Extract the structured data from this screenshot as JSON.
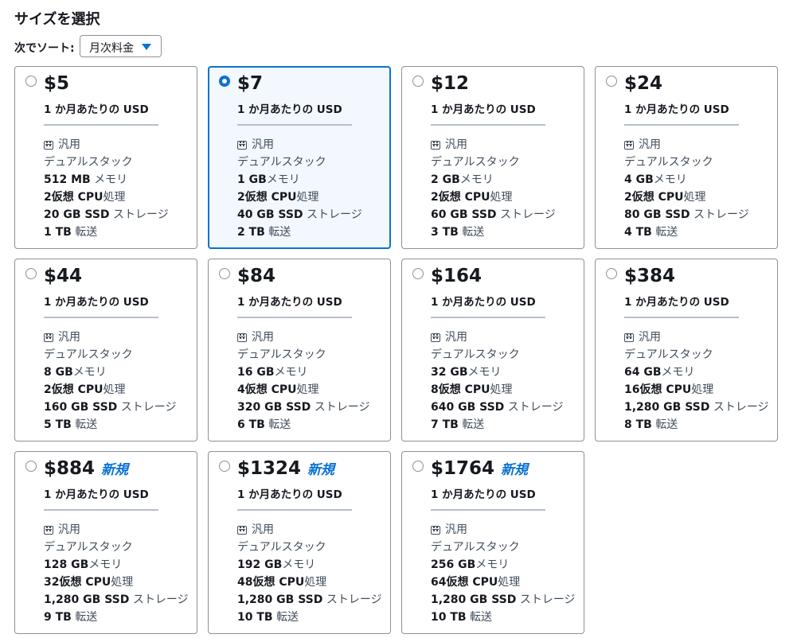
{
  "header": {
    "title": "サイズを選択",
    "sort_label": "次でソート:",
    "sort_value": "月次料金"
  },
  "labels": {
    "unit": "1 か月あたりの USD",
    "general": "汎用",
    "dual_stack": "デュアルスタック",
    "memory_suffix": "メモリ",
    "vcpu_suffix": "仮想 CPU",
    "processing": "処理",
    "storage_suffix": "GB SSD",
    "storage_word": " ストレージ",
    "transfer_suffix": "TB",
    "transfer_word": " 転送",
    "new_badge": "新規"
  },
  "plans": [
    {
      "price": "$5",
      "memory": "512 MB",
      "memory_spaced": true,
      "vcpu": "2",
      "storage": "20",
      "transfer": "1",
      "is_new": false,
      "selected": false
    },
    {
      "price": "$7",
      "memory": "1 GB",
      "memory_spaced": false,
      "vcpu": "2",
      "storage": "40",
      "transfer": "2",
      "is_new": false,
      "selected": true
    },
    {
      "price": "$12",
      "memory": "2 GB",
      "memory_spaced": false,
      "vcpu": "2",
      "storage": "60",
      "transfer": "3",
      "is_new": false,
      "selected": false
    },
    {
      "price": "$24",
      "memory": "4 GB",
      "memory_spaced": false,
      "vcpu": "2",
      "storage": "80",
      "transfer": "4",
      "is_new": false,
      "selected": false
    },
    {
      "price": "$44",
      "memory": "8 GB",
      "memory_spaced": false,
      "vcpu": "2",
      "storage": "160",
      "transfer": "5",
      "is_new": false,
      "selected": false
    },
    {
      "price": "$84",
      "memory": "16 GB",
      "memory_spaced": false,
      "vcpu": "4",
      "storage": "320",
      "transfer": "6",
      "is_new": false,
      "selected": false
    },
    {
      "price": "$164",
      "memory": "32 GB",
      "memory_spaced": false,
      "vcpu": "8",
      "storage": "640",
      "transfer": "7",
      "is_new": false,
      "selected": false
    },
    {
      "price": "$384",
      "memory": "64 GB",
      "memory_spaced": false,
      "vcpu": "16",
      "storage": "1,280",
      "transfer": "8",
      "is_new": false,
      "selected": false
    },
    {
      "price": "$884",
      "memory": "128 GB",
      "memory_spaced": false,
      "vcpu": "32",
      "storage": "1,280",
      "transfer": "9",
      "is_new": true,
      "selected": false
    },
    {
      "price": "$1324",
      "memory": "192 GB",
      "memory_spaced": false,
      "vcpu": "48",
      "storage": "1,280",
      "transfer": "10",
      "is_new": true,
      "selected": false
    },
    {
      "price": "$1764",
      "memory": "256 GB",
      "memory_spaced": false,
      "vcpu": "64",
      "storage": "1,280",
      "transfer": "10",
      "is_new": true,
      "selected": false
    }
  ]
}
